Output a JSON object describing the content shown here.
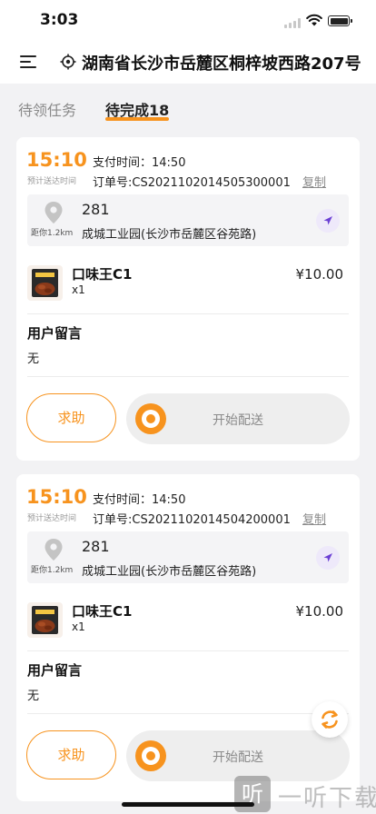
{
  "status_bar": {
    "time": "3:03"
  },
  "header": {
    "location": "湖南省长沙市岳麓区桐梓坡西路207号"
  },
  "tabs": {
    "pending_label": "待领任务",
    "active_label": "待完成18"
  },
  "orders": [
    {
      "eta_time": "15:10",
      "eta_label": "预计送达时间",
      "pay_time": "支付时间：14:50",
      "order_no": "订单号:CS2021102014505300001",
      "copy_label": "复制",
      "address_number": "281",
      "address_street": "成城工业园(长沙市岳麓区谷苑路)",
      "distance": "距你1.2km",
      "product_name": "口味王C1",
      "product_qty": "x1",
      "product_price": "¥10.00",
      "remark_title": "用户留言",
      "remark_text": "无",
      "help_label": "求助",
      "slide_label": "开始配送"
    },
    {
      "eta_time": "15:10",
      "eta_label": "预计送达时间",
      "pay_time": "支付时间：14:50",
      "order_no": "订单号:CS2021102014504200001",
      "copy_label": "复制",
      "address_number": "281",
      "address_street": "成城工业园(长沙市岳麓区谷苑路)",
      "distance": "距你1.2km",
      "product_name": "口味王C1",
      "product_qty": "x1",
      "product_price": "¥10.00",
      "remark_title": "用户留言",
      "remark_text": "无",
      "help_label": "求助",
      "slide_label": "开始配送"
    }
  ],
  "watermark": {
    "glyph": "听",
    "text": "一听下载"
  },
  "colors": {
    "accent": "#f7931e",
    "nav_icon": "#6b3fd4"
  }
}
